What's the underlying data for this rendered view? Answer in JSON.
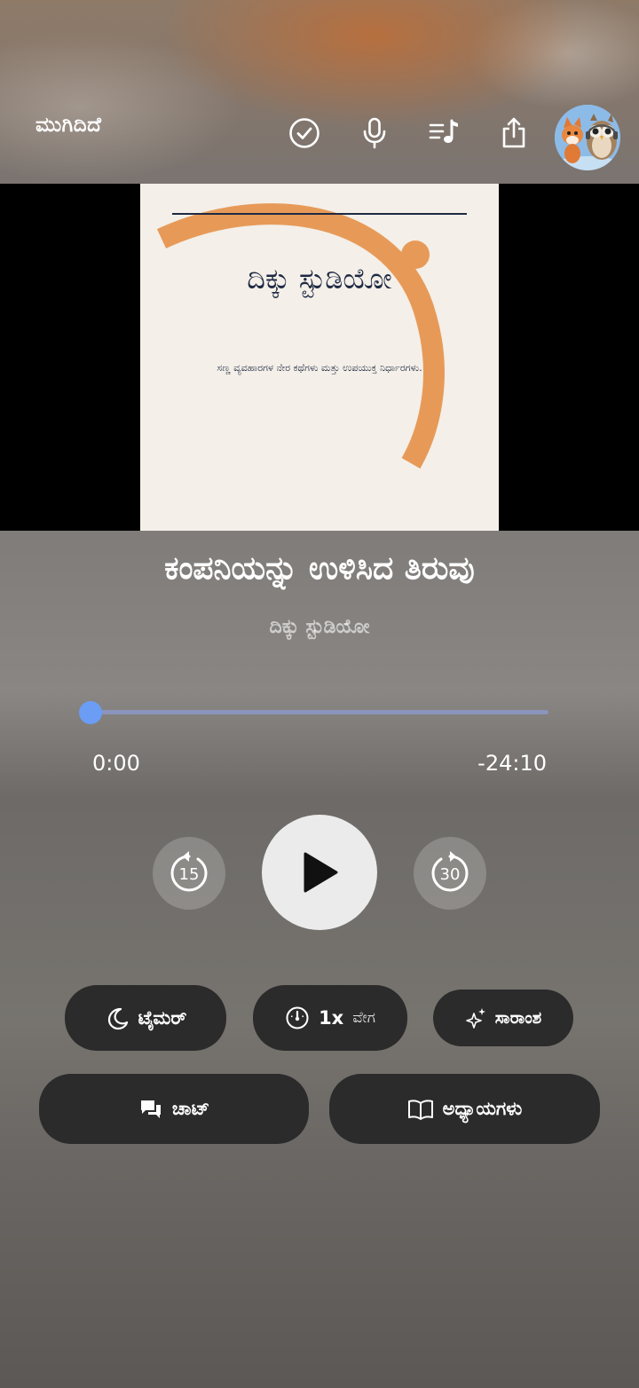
{
  "topbar": {
    "done_label": "ಮುಗಿದಿದೆ",
    "icons": [
      "check-circle-icon",
      "microphone-icon",
      "playlist-icon",
      "share-icon",
      "avatar"
    ]
  },
  "cover": {
    "title": "ದಿಕ್ಕು ಸ್ಟುಡಿಯೋ",
    "subtitle": "ಸಣ್ಣ ವ್ಯವಹಾರಗಳ ನೇರ ಕಥೆಗಳು ಮತ್ತು ಉಪಯುಕ್ತ ನಿರ್ಧಾರಗಳು.",
    "accent_color": "#e79a58",
    "text_color": "#1e2a44"
  },
  "track": {
    "title": "ಕಂಪನಿಯನ್ನು ಉಳಿಸಿದ ತಿರುವು",
    "artist": "ದಿಕ್ಕು ಸ್ಟುಡಿಯೋ"
  },
  "progress": {
    "elapsed": "0:00",
    "remaining": "-24:10",
    "fraction": 0.0
  },
  "controls": {
    "rewind_seconds": "15",
    "forward_seconds": "30"
  },
  "actions": {
    "timer_label": "ಟೈಮರ್",
    "speed_value": "1x",
    "speed_label": "ವೇಗ",
    "summary_label": "ಸಾರಾಂಶ",
    "chat_label": "ಚಾಟ್",
    "chapters_label": "ಅಧ್ಯಾಯಗಳು"
  },
  "colors": {
    "progress_accent": "#6b9df5",
    "pill_bg": "#2b2b2b",
    "play_bg": "#ebebeb"
  }
}
